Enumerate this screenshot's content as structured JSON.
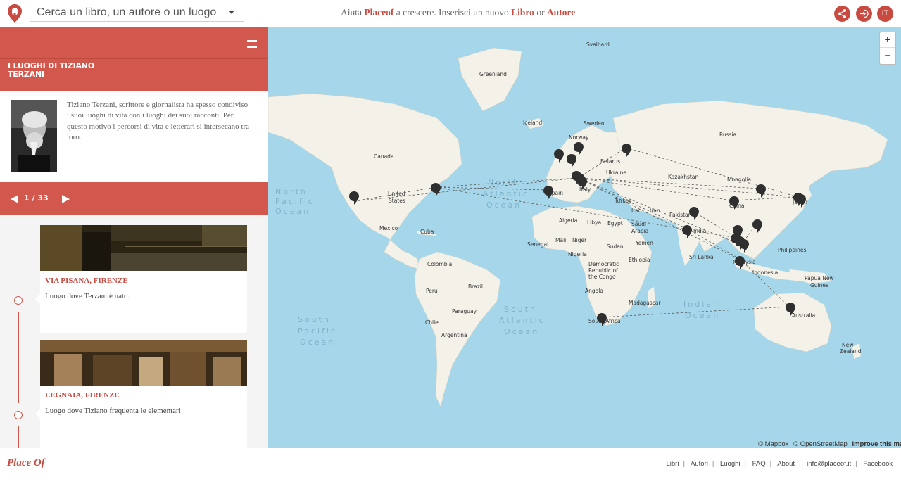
{
  "search": {
    "placeholder": "Cerca un libro, un autore o un luogo"
  },
  "tagline": {
    "part1": "Aiuta ",
    "placeof": "Placeof",
    "part2": " a crescere. Inserisci un nuovo ",
    "libro": "Libro",
    "or": " or ",
    "autore": "Autore"
  },
  "header_buttons": {
    "share_icon": "share-icon",
    "login_icon": "login-icon",
    "language": "IT"
  },
  "panel": {
    "title": "I LUOGHI DI TIZIANO TERZANI",
    "description": "Tiziano Terzani, scrittore e giornalista ha spesso condiviso i suoi luoghi di vita con i luoghi dei suoi racconti. Per questo motivo i percorsi di vita e letterari si intersecano tra loro.",
    "counter": "1 / 33"
  },
  "places": [
    {
      "title": "VIA PISANA, FIRENZE",
      "text": "Luogo dove Terzani è nato."
    },
    {
      "title": "LEGNAIA, FIRENZE",
      "text": "Luogo dove Tiziano frequenta le elementari"
    }
  ],
  "map": {
    "ocean_labels": [
      "North Pacific Ocean",
      "North Atlantic Ocean",
      "South Pacific Ocean",
      "South Atlantic Ocean",
      "Indian Ocean"
    ],
    "country_labels": [
      "Svalbard",
      "Greenland",
      "Iceland",
      "Sweden",
      "Norway",
      "Russia",
      "Canada",
      "United States",
      "Mexico",
      "Cuba",
      "Colombia",
      "Brazil",
      "Peru",
      "Paraguay",
      "Argentina",
      "Chile",
      "Spain",
      "Italy",
      "Algeria",
      "Libya",
      "Egypt",
      "Mali",
      "Niger",
      "Nigeria",
      "Sudan",
      "Senegal",
      "Ethiopia",
      "Angola",
      "South Africa",
      "Madagascar",
      "Democratic Republic of the Congo",
      "Turkey",
      "Iraq",
      "Iran",
      "Saudi Arabia",
      "Yemen",
      "Pakistan",
      "India",
      "Sri Lanka",
      "China",
      "Mongolia",
      "Kazakhstan",
      "Ukraine",
      "Belarus",
      "Japan",
      "Philippines",
      "Malaysia",
      "Papua New Guinea",
      "Australia",
      "New Zealand",
      "Indonesia"
    ],
    "zoom_in": "+",
    "zoom_out": "−",
    "attribution": [
      "© Mapbox",
      "© OpenStreetMap",
      "Improve this map"
    ]
  },
  "footer": {
    "logo": "Place Of",
    "links": [
      "Libri",
      "Autori",
      "Luoghi",
      "FAQ",
      "About",
      "info@placeof.it",
      "Facebook"
    ]
  }
}
